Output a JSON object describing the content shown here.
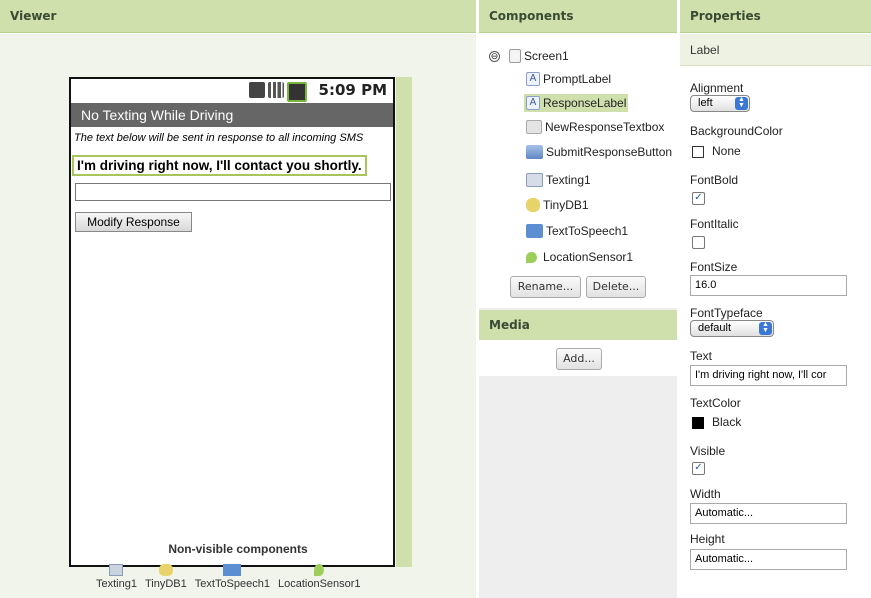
{
  "headers": {
    "viewer": "Viewer",
    "components": "Components",
    "properties": "Properties",
    "media": "Media"
  },
  "phone": {
    "time": "5:09 PM",
    "title": "No Texting While Driving",
    "prompt_text": "The text below will be sent in response to all incoming SMS",
    "response_text": "I'm driving right now, I'll contact you shortly.",
    "input_value": "",
    "button_label": "Modify Response"
  },
  "nonvisible": {
    "title": "Non-visible components",
    "items": [
      "Texting1",
      "TinyDB1",
      "TextToSpeech1",
      "LocationSensor1"
    ]
  },
  "components": {
    "collapse_symbol": "⊖",
    "root": "Screen1",
    "children": [
      "PromptLabel",
      "ResponseLabel",
      "NewResponseTextbox",
      "SubmitResponseButton",
      "Texting1",
      "TinyDB1",
      "TextToSpeech1",
      "LocationSensor1"
    ],
    "selected": "ResponseLabel",
    "rename_label": "Rename...",
    "delete_label": "Delete..."
  },
  "media": {
    "add_label": "Add..."
  },
  "properties": {
    "component": "Label",
    "alignment": {
      "label": "Alignment",
      "value": "left"
    },
    "background_color": {
      "label": "BackgroundColor",
      "value": "None"
    },
    "font_bold": {
      "label": "FontBold",
      "checked": true
    },
    "font_italic": {
      "label": "FontItalic",
      "checked": false
    },
    "font_size": {
      "label": "FontSize",
      "value": "16.0"
    },
    "font_typeface": {
      "label": "FontTypeface",
      "value": "default"
    },
    "text": {
      "label": "Text",
      "value": "I'm driving right now, I'll cor"
    },
    "text_color": {
      "label": "TextColor",
      "value": "Black",
      "color": "#000000"
    },
    "visible": {
      "label": "Visible",
      "checked": true
    },
    "width": {
      "label": "Width",
      "value": "Automatic..."
    },
    "height": {
      "label": "Height",
      "value": "Automatic..."
    }
  },
  "colors": {
    "accent": "#cfe0ad",
    "selection": "#cfe0ad",
    "title_bar": "#666666"
  },
  "icons": {
    "status": [
      "signal-g-icon",
      "signal-bars-icon",
      "battery-icon"
    ],
    "components": [
      "screen-icon",
      "label-icon",
      "label-icon",
      "textbox-icon",
      "button-icon",
      "texting-icon",
      "tinydb-icon",
      "speech-icon",
      "location-icon"
    ]
  }
}
